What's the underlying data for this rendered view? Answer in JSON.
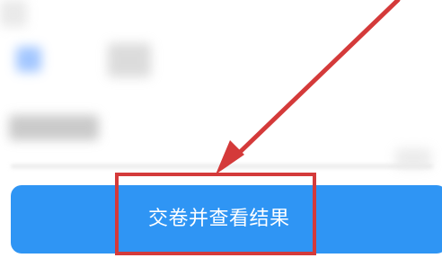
{
  "main": {
    "submit_button_label": "交卷并查看结果"
  },
  "colors": {
    "button_blue": "#2f95f4",
    "annotation_red": "#d43a3a",
    "text_white": "#ffffff"
  },
  "annotations": {
    "arrow_icon": "arrow-icon",
    "highlight_box": "red-highlight-box"
  }
}
